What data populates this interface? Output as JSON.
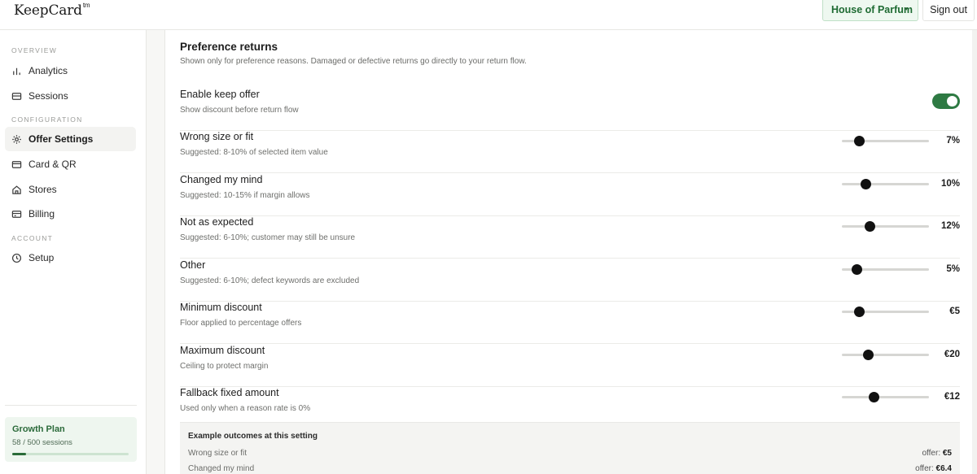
{
  "topbar": {
    "logo": "KeepCard",
    "logo_mark": "tm",
    "store_selector": "House of Parfum",
    "store_caret": "▾",
    "sign_out": "Sign out"
  },
  "sidebar": {
    "sections": {
      "overview": "OVERVIEW",
      "configuration": "CONFIGURATION",
      "account": "ACCOUNT"
    },
    "items": [
      {
        "label": "Analytics",
        "icon": "bar-chart-icon"
      },
      {
        "label": "Sessions",
        "icon": "card-stack-icon"
      },
      {
        "label": "Offer Settings",
        "icon": "gear-icon",
        "active": true
      },
      {
        "label": "Card & QR",
        "icon": "credit-card-icon"
      },
      {
        "label": "Stores",
        "icon": "home-icon"
      },
      {
        "label": "Billing",
        "icon": "billing-card-icon"
      },
      {
        "label": "Setup",
        "icon": "clock-icon"
      }
    ],
    "plan": {
      "title": "Growth Plan",
      "usage": "58 / 500 sessions",
      "used": 58,
      "limit": 500
    }
  },
  "main": {
    "title": "Preference returns",
    "subtitle": "Shown only for preference reasons. Damaged or defective returns go directly to your return flow.",
    "toggle_row": {
      "label": "Enable keep offer",
      "hint": "Show discount before return flow",
      "enabled": true
    },
    "rows": [
      {
        "label": "Wrong size or fit",
        "hint": "Suggested: 8-10% of selected item value",
        "value": "7%",
        "level": 0.2
      },
      {
        "label": "Changed my mind",
        "hint": "Suggested: 10-15% if margin allows",
        "value": "10%",
        "level": 0.27
      },
      {
        "label": "Not as expected",
        "hint": "Suggested: 6-10%; customer may still be unsure",
        "value": "12%",
        "level": 0.32
      },
      {
        "label": "Other",
        "hint": "Suggested: 6-10%; defect keywords are excluded",
        "value": "5%",
        "level": 0.17
      },
      {
        "label": "Minimum discount",
        "hint": "Floor applied to percentage offers",
        "value": "€5",
        "level": 0.2
      },
      {
        "label": "Maximum discount",
        "hint": "Ceiling to protect margin",
        "value": "€20",
        "level": 0.3
      },
      {
        "label": "Fallback fixed amount",
        "hint": "Used only when a reason rate is 0%",
        "value": "€12",
        "level": 0.36
      }
    ],
    "example": {
      "title": "Example outcomes at this setting",
      "offer_prefix": "offer:",
      "rows": [
        {
          "name": "Wrong size or fit",
          "offer": "€5"
        },
        {
          "name": "Changed my mind",
          "offer": "€6.4"
        }
      ]
    }
  },
  "colors": {
    "accent": "#2e7a43",
    "store_bg": "#eef8f0",
    "plan_bg": "#eef6ef"
  }
}
